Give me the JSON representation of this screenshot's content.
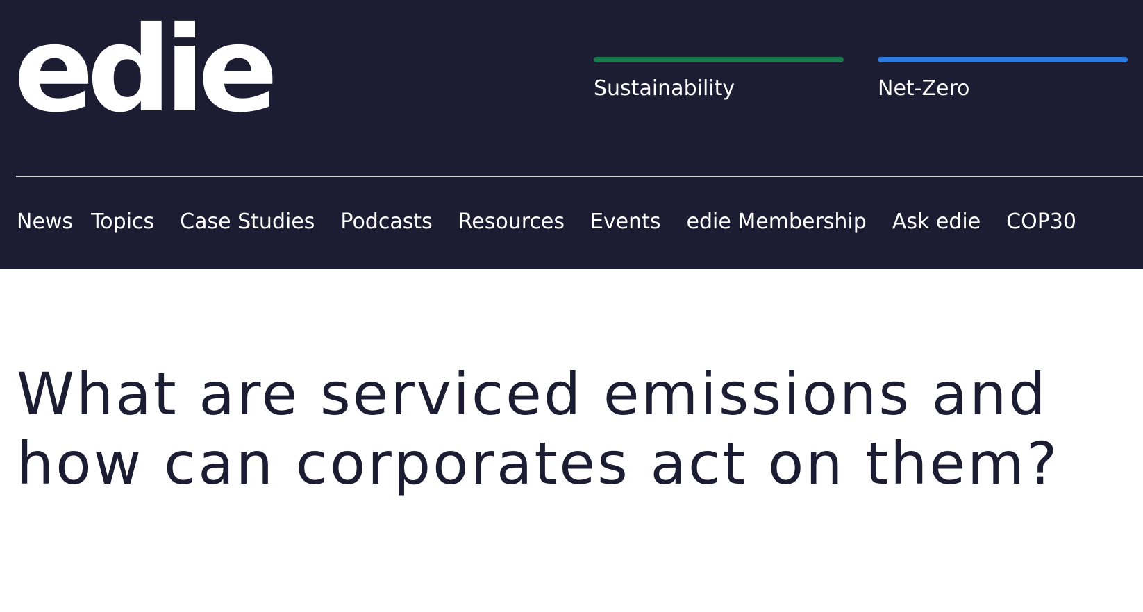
{
  "header": {
    "logo_text": "edie",
    "channels": [
      {
        "label": "Sustainability",
        "color": "#1a7a4e"
      },
      {
        "label": "Net-Zero",
        "color": "#2e7be0"
      }
    ],
    "nav_items": [
      {
        "label": "News"
      },
      {
        "label": "Topics"
      },
      {
        "label": "Case Studies"
      },
      {
        "label": "Podcasts"
      },
      {
        "label": "Resources"
      },
      {
        "label": "Events"
      },
      {
        "label": "edie Membership"
      },
      {
        "label": "Ask edie"
      },
      {
        "label": "COP30"
      }
    ]
  },
  "article": {
    "title": "What are serviced emissions and how can corporates act on them?"
  },
  "colors": {
    "header_background": "#1c1c33",
    "headline_text": "#1c1c33"
  }
}
